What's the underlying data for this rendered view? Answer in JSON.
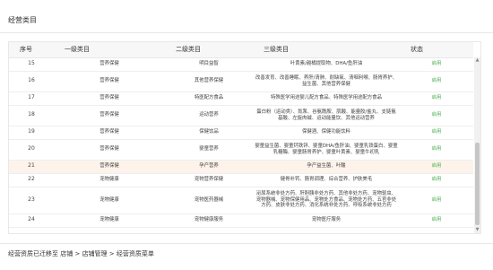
{
  "page": {
    "title": "经营类目"
  },
  "table": {
    "headers": [
      "序号",
      "一级类目",
      "二级类目",
      "三级类目",
      "状态"
    ],
    "rows": [
      {
        "idx": "15",
        "l1": "营养保健",
        "l2": "明目益智",
        "l3": "叶黄素/越橘提取物、DHA/鱼肝油",
        "status": "启用"
      },
      {
        "idx": "16",
        "l1": "营养保健",
        "l2": "其他营养保健",
        "l3": "改善发育、改善睡眠、养肝/清肺、耐缺氧、清咽利喉、肠胃养护、益生菌、其他营养保健",
        "status": "启用"
      },
      {
        "idx": "17",
        "l1": "营养保健",
        "l2": "特医配方食品",
        "l3": "特殊医学用途婴儿配方食品、特殊医学用途配方食品",
        "status": "启用"
      },
      {
        "idx": "18",
        "l1": "营养保健",
        "l2": "运动营养",
        "l3": "蛋白粉（运动类）、氮泵、谷氨酰胺、肌酸、能量胶/盐丸、支链氨基酸、左旋肉碱、运动能量饮、其他运动营养",
        "status": "启用"
      },
      {
        "idx": "19",
        "l1": "营养保健",
        "l2": "保健饮品",
        "l3": "保健酒、保健功能饮料",
        "status": "启用"
      },
      {
        "idx": "20",
        "l1": "营养保健",
        "l2": "婴童营养",
        "l3": "婴童益生菌、婴童钙铁锌、婴童DHA/鱼肝油、婴童乳铁蛋白、婴童乳糖酶、婴童肠胃养护、婴童叶黄素、婴童牛初乳",
        "status": "启用"
      },
      {
        "idx": "21",
        "l1": "营养保健",
        "l2": "孕产营养",
        "l3": "孕产益生菌、叶酸",
        "status": "启用",
        "highlight": true
      },
      {
        "idx": "22",
        "l1": "宠物健康",
        "l2": "宠物营养保健",
        "l3": "健骨补钙、肠胃调理、综合营养、护肤美毛",
        "status": "启用"
      },
      {
        "idx": "23",
        "l1": "宠物健康",
        "l2": "宠物医药器械",
        "l3": "泌尿系统非处方药、肝胆胰非处方药、其他非处方药、宠物驱虫、宠物器械、宠物保健用品、宠物处方食品、宠物处方药、五官非处方药、皮肤非处方药、消化系统非处方药、呼吸系统非处方药",
        "status": "启用"
      },
      {
        "idx": "24",
        "l1": "宠物健康",
        "l2": "宠物健康服务",
        "l3": "宠物医疗服务",
        "status": "启用"
      }
    ]
  },
  "scrollbar": {
    "up": "▲",
    "down": "▼"
  },
  "footer": {
    "prefix": "经营资质已迁移至 ",
    "link_store": "店铺",
    "sep1": " > ",
    "link_manage": "店铺管理",
    "sep2": " > ",
    "link_menu": "经营资质菜单"
  }
}
